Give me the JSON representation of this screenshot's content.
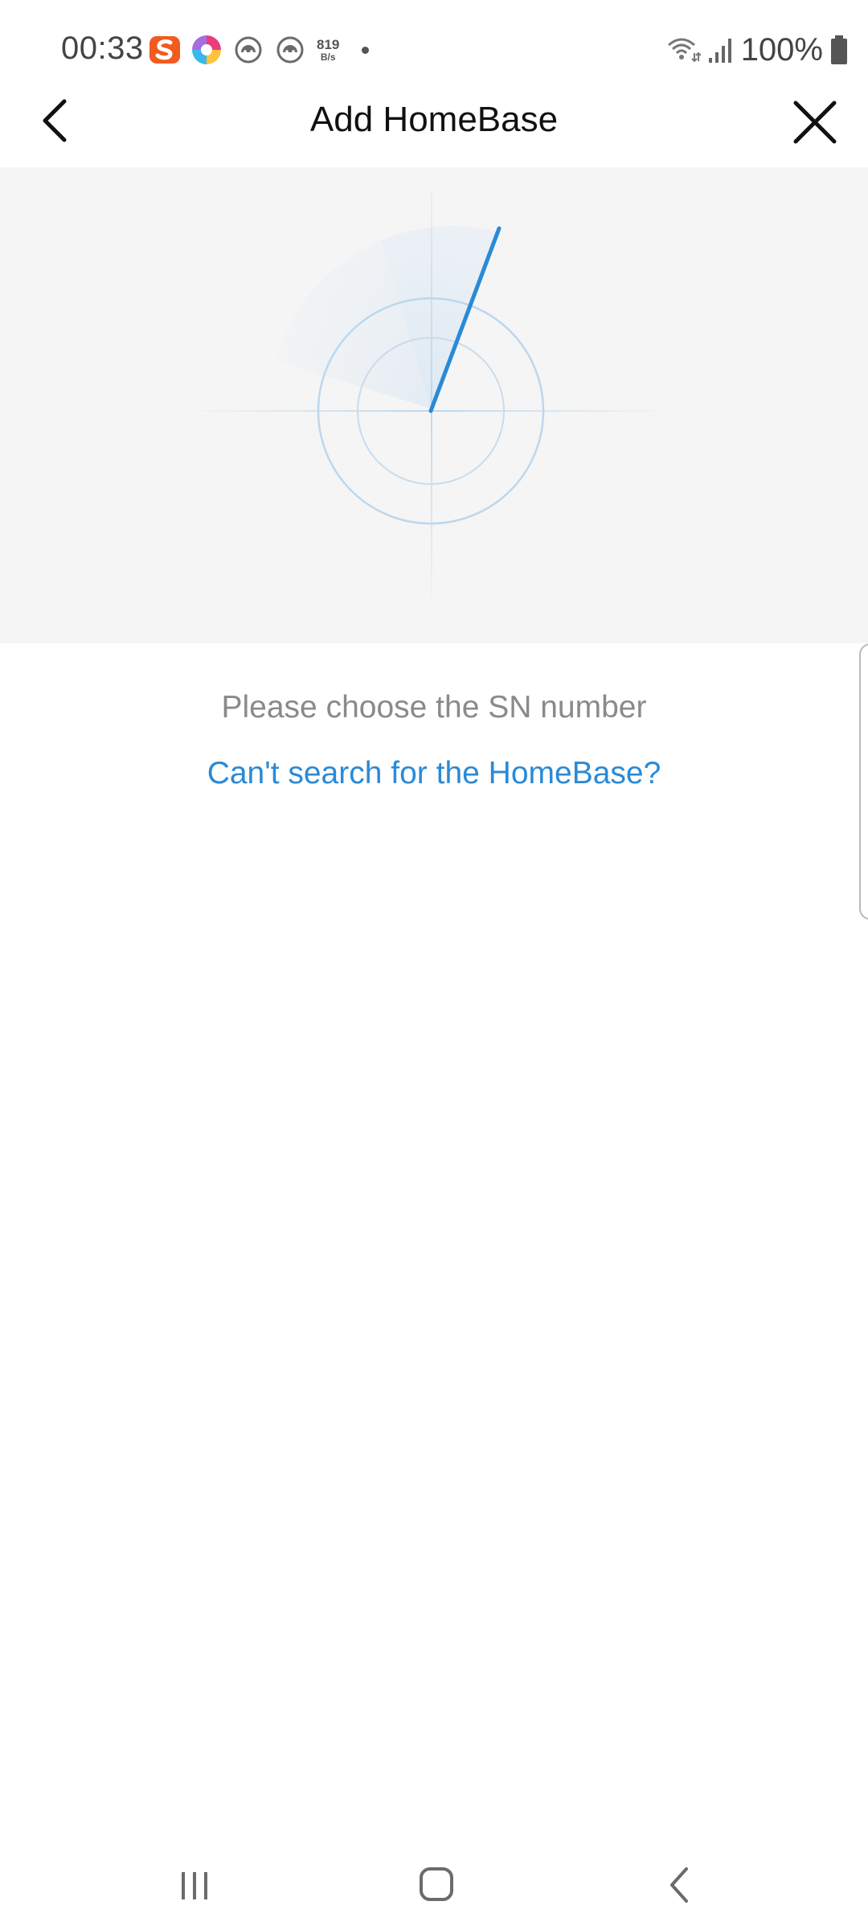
{
  "status_bar": {
    "time": "00:33",
    "net_speed_value": "819",
    "net_speed_unit": "B/s",
    "battery_percent": "100%"
  },
  "header": {
    "title": "Add HomeBase"
  },
  "main": {
    "prompt": "Please choose the SN number",
    "help_link": "Can't search for the HomeBase?"
  },
  "colors": {
    "accent": "#2a8ad6",
    "radar_light": "#bcd7ee",
    "panel_bg": "#f5f5f5"
  },
  "icons": {
    "back": "chevron-left-icon",
    "close": "close-icon",
    "nav_recents": "recents-icon",
    "nav_home": "home-icon",
    "nav_back": "back-icon"
  }
}
